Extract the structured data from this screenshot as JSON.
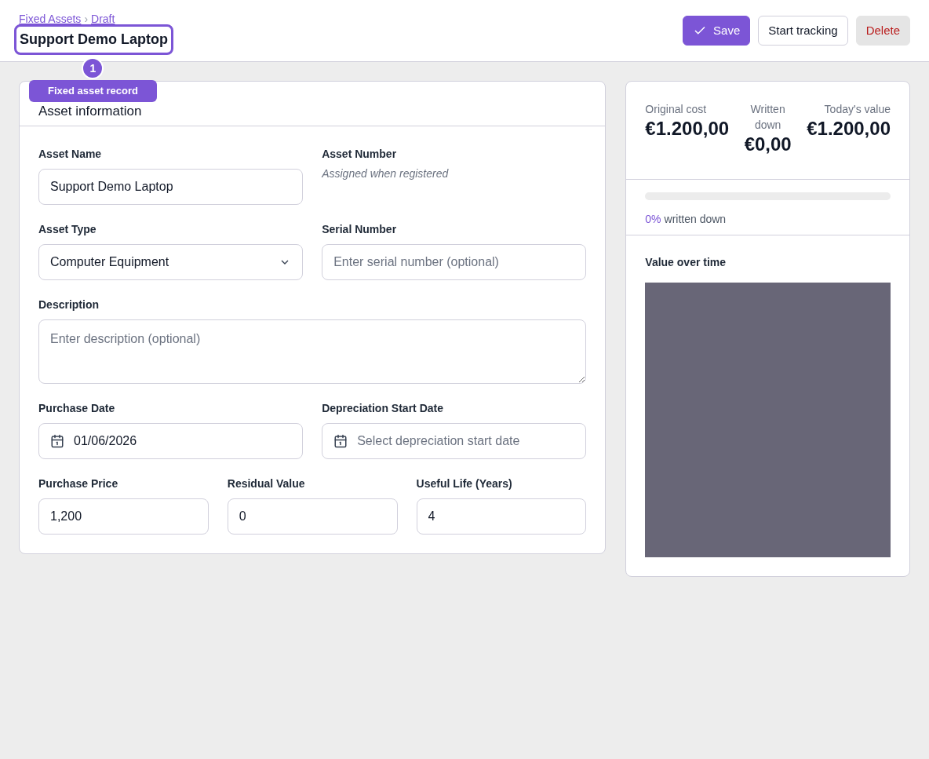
{
  "breadcrumb": [
    "Fixed Assets",
    "Draft"
  ],
  "breadcrumb_separator": "›",
  "title": "Support Demo Laptop",
  "actions": [
    {
      "label": "Save",
      "kind": "primary"
    },
    {
      "label": "Start tracking",
      "kind": "outline"
    },
    {
      "label": "Delete",
      "kind": "danger"
    }
  ],
  "callout": {
    "number": "1",
    "label": "Fixed asset record"
  },
  "form": {
    "heading": "Asset information",
    "rows": [
      [
        {
          "label": "Asset Name",
          "kind": "text",
          "value": "Support Demo Laptop"
        },
        {
          "label": "Asset Number",
          "kind": "note",
          "value": "Assigned when registered"
        }
      ],
      [
        {
          "label": "Asset Type",
          "kind": "select",
          "value": "Computer Equipment"
        },
        {
          "label": "Serial Number",
          "kind": "text",
          "placeholder": "Enter serial number (optional)"
        }
      ],
      [
        {
          "label": "Description",
          "kind": "textarea",
          "placeholder": "Enter description (optional)"
        }
      ],
      [
        {
          "label": "Purchase Date",
          "kind": "date",
          "value": "01/06/2026"
        },
        {
          "label": "Depreciation Start Date",
          "kind": "date",
          "placeholder": "Select depreciation start date"
        }
      ],
      [
        {
          "label": "Purchase Price",
          "kind": "text",
          "value": "1,200"
        },
        {
          "label": "Residual Value",
          "kind": "text",
          "value": "0"
        },
        {
          "label": "Useful Life (Years)",
          "kind": "text",
          "value": "4"
        }
      ]
    ]
  },
  "summary": {
    "stats": [
      {
        "label": "Original cost",
        "value": "€1.200,00"
      },
      {
        "label": "Written down",
        "value": "€0,00"
      },
      {
        "label": "Today's value",
        "value": "€1.200,00"
      }
    ],
    "progress": {
      "level": 0,
      "percent": "0%",
      "caption": "written down"
    },
    "chart_title": "Value over time"
  }
}
